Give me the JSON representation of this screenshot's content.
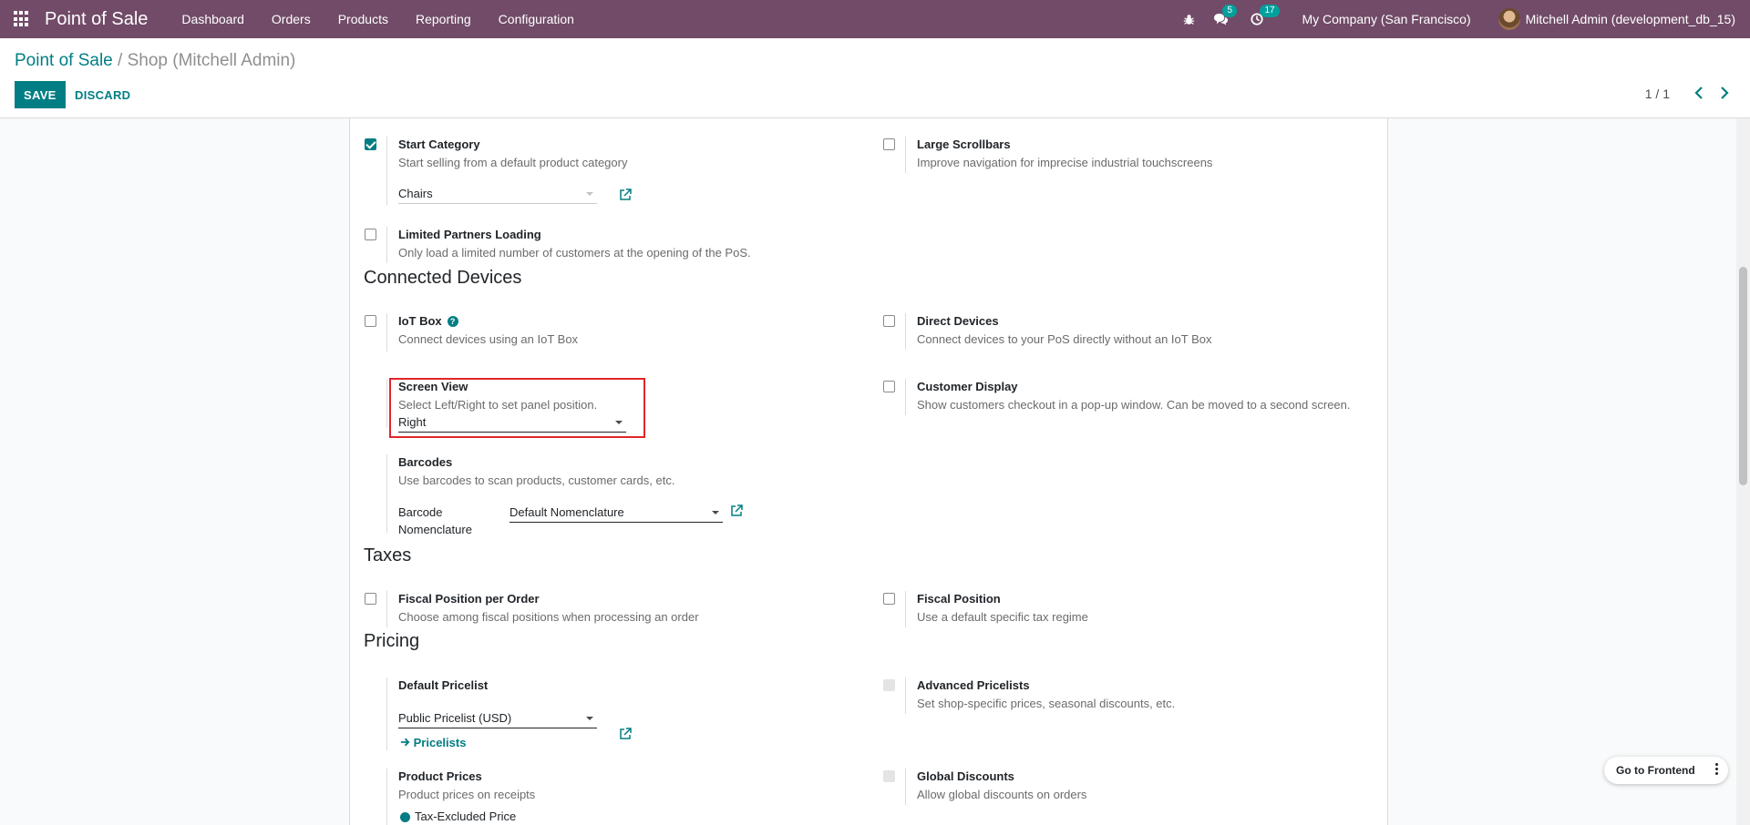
{
  "navbar": {
    "brand": "Point of Sale",
    "menu": [
      "Dashboard",
      "Orders",
      "Products",
      "Reporting",
      "Configuration"
    ],
    "messages_count": "5",
    "activities_count": "17",
    "company": "My Company (San Francisco)",
    "user": "Mitchell Admin (development_db_15)"
  },
  "breadcrumb": {
    "parent": "Point of Sale",
    "separator": "/",
    "current": "Shop (Mitchell Admin)"
  },
  "actions": {
    "save": "SAVE",
    "discard": "DISCARD"
  },
  "pager": {
    "value": "1 / 1"
  },
  "settings": {
    "start_category": {
      "title": "Start Category",
      "desc": "Start selling from a default product category",
      "value": "Chairs",
      "checked": true
    },
    "large_scrollbars": {
      "title": "Large Scrollbars",
      "desc": "Improve navigation for imprecise industrial touchscreens",
      "checked": false
    },
    "limited_partners": {
      "title": "Limited Partners Loading",
      "desc": "Only load a limited number of customers at the opening of the PoS.",
      "checked": false
    }
  },
  "connected_devices": {
    "title": "Connected Devices",
    "iot_box": {
      "title": "IoT Box",
      "desc": "Connect devices using an IoT Box",
      "help": "?"
    },
    "direct_devices": {
      "title": "Direct Devices",
      "desc": "Connect devices to your PoS directly without an IoT Box"
    },
    "screen_view": {
      "title": "Screen View",
      "desc": "Select Left/Right to set panel position.",
      "value": "Right"
    },
    "customer_display": {
      "title": "Customer Display",
      "desc": "Show customers checkout in a pop-up window. Can be moved to a second screen."
    },
    "barcodes": {
      "title": "Barcodes",
      "desc": "Use barcodes to scan products, customer cards, etc.",
      "nomenclature_label_1": "Barcode",
      "nomenclature_label_2": "Nomenclature",
      "nomenclature_value": "Default Nomenclature"
    }
  },
  "taxes": {
    "title": "Taxes",
    "fiscal_per_order": {
      "title": "Fiscal Position per Order",
      "desc": "Choose among fiscal positions when processing an order"
    },
    "fiscal_position": {
      "title": "Fiscal Position",
      "desc": "Use a default specific tax regime"
    }
  },
  "pricing": {
    "title": "Pricing",
    "default_pricelist": {
      "title": "Default Pricelist",
      "value": "Public Pricelist (USD)",
      "link": "Pricelists"
    },
    "advanced_pricelists": {
      "title": "Advanced Pricelists",
      "desc": "Set shop-specific prices, seasonal discounts, etc."
    },
    "product_prices": {
      "title": "Product Prices",
      "desc": "Product prices on receipts",
      "option": "Tax-Excluded Price"
    },
    "global_discounts": {
      "title": "Global Discounts",
      "desc": "Allow global discounts on orders"
    }
  },
  "frontend": {
    "label": "Go to Frontend"
  },
  "colors": {
    "navbar": "#714b67",
    "primary": "#017e84",
    "highlight": "#e0262b"
  }
}
